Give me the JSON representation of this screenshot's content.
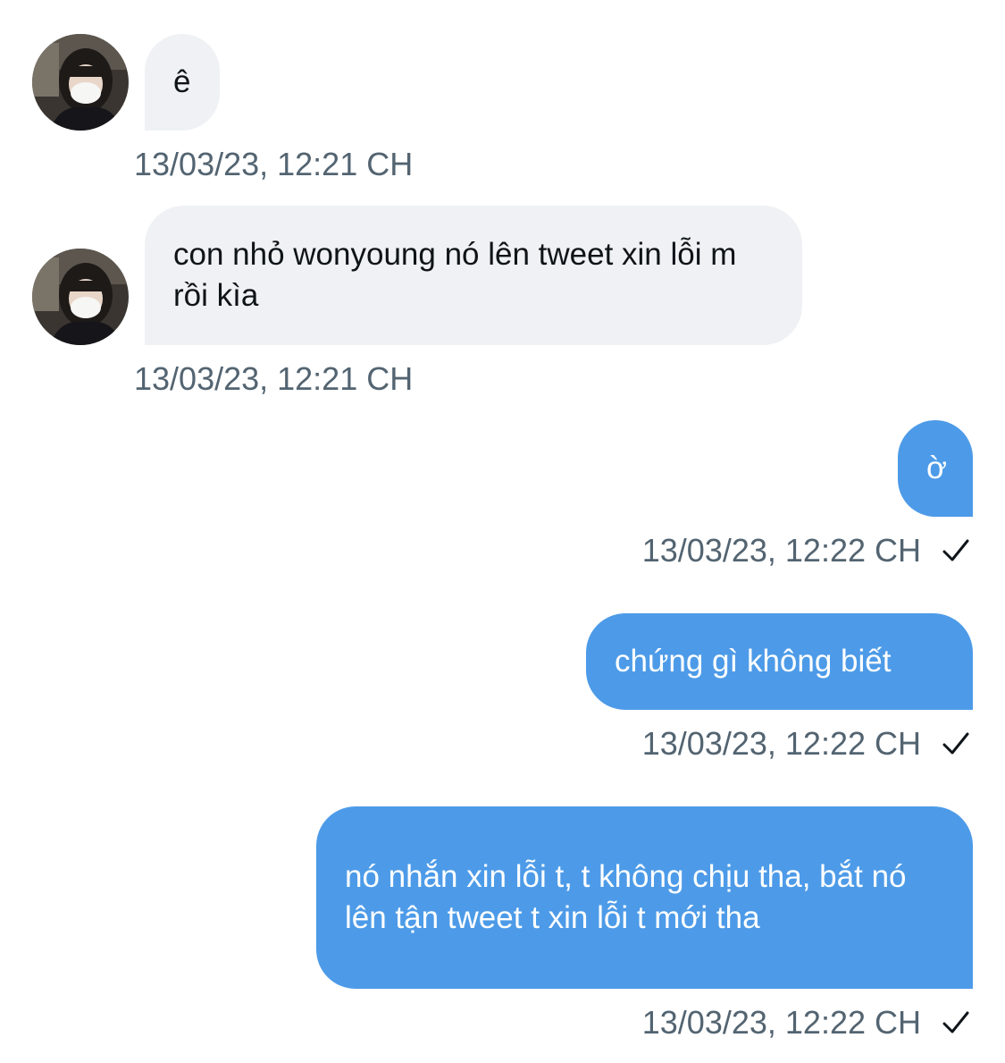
{
  "messages": [
    {
      "direction": "incoming",
      "text": "ê",
      "timestamp": "13/03/23, 12:21 CH"
    },
    {
      "direction": "incoming",
      "text": "con nhỏ wonyoung nó lên tweet xin lỗi m rồi kìa",
      "timestamp": "13/03/23, 12:21 CH"
    },
    {
      "direction": "outgoing",
      "text": "ờ",
      "timestamp": "13/03/23, 12:22 CH",
      "status": "sent-check-icon"
    },
    {
      "direction": "outgoing",
      "text": "chứng gì không biết",
      "timestamp": "13/03/23, 12:22 CH",
      "status": "sent-check-icon"
    },
    {
      "direction": "outgoing",
      "text": "nó nhắn xin lỗi t, t không chịu tha, bắt nó lên tận tweet t xin lỗi t mới tha",
      "timestamp": "13/03/23, 12:22 CH",
      "status": "sent-check-icon"
    }
  ],
  "colors": {
    "incoming_bubble": "#eff1f4",
    "outgoing_bubble": "#4d9be8",
    "timestamp": "#536471"
  }
}
